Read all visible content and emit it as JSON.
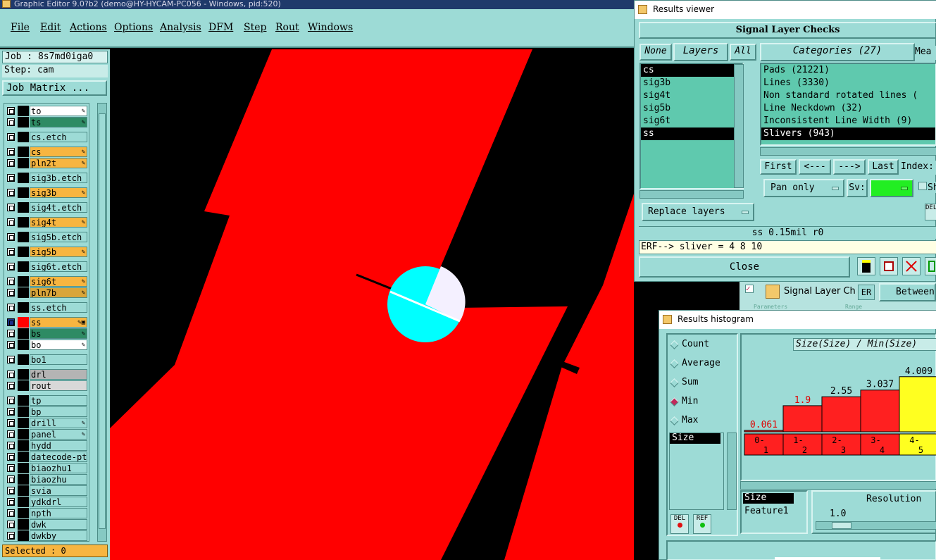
{
  "title_bar": {
    "text": "Graphic Editor 9.0?b2 (demo@HY-HYCAM-PC056 - Windows, pid:520)"
  },
  "menu": [
    "File",
    "Edit",
    "Actions",
    "Options",
    "Analysis",
    "DFM",
    "Step",
    "Rout",
    "Windows"
  ],
  "left_panel": {
    "job": "Job : 8s7md0iga0",
    "step": "Step: cam",
    "job_matrix": "Job Matrix ...",
    "selected": "Selected : 0",
    "layers": [
      {
        "name": "to",
        "bg": "#ffffff",
        "flag": "✎"
      },
      {
        "name": "ts",
        "bg": "#2e8b64",
        "flag": "✎"
      },
      {
        "name": "cs.etch",
        "bg": "#9ddbd6",
        "flag": ""
      },
      {
        "name": "cs",
        "bg": "#f7b540",
        "flag": "✎"
      },
      {
        "name": "pln2t",
        "bg": "#f7b540",
        "flag": "✎"
      },
      {
        "name": "sig3b.etch",
        "bg": "#9ddbd6",
        "flag": ""
      },
      {
        "name": "sig3b",
        "bg": "#f7b540",
        "flag": "✎"
      },
      {
        "name": "sig4t.etch",
        "bg": "#9ddbd6",
        "flag": ""
      },
      {
        "name": "sig4t",
        "bg": "#f7b540",
        "flag": "✎"
      },
      {
        "name": "sig5b.etch",
        "bg": "#9ddbd6",
        "flag": ""
      },
      {
        "name": "sig5b",
        "bg": "#f7b540",
        "flag": "✎"
      },
      {
        "name": "sig6t.etch",
        "bg": "#9ddbd6",
        "flag": ""
      },
      {
        "name": "sig6t",
        "bg": "#f7b540",
        "flag": "✎"
      },
      {
        "name": "pln7b",
        "bg": "#d9a53a",
        "flag": "✎"
      },
      {
        "name": "ss.etch",
        "bg": "#9ddbd6",
        "flag": ""
      },
      {
        "name": "ss",
        "bg": "#f7b540",
        "flag": "✎▣"
      },
      {
        "name": "bs",
        "bg": "#2e8b64",
        "flag": "✎"
      },
      {
        "name": "bo",
        "bg": "#ffffff",
        "flag": "✎"
      },
      {
        "name": "bo1",
        "bg": "#9ddbd6",
        "flag": ""
      },
      {
        "name": "drl",
        "bg": "#b4b4b4",
        "flag": ""
      },
      {
        "name": "rout",
        "bg": "#d8d8d8",
        "flag": ""
      },
      {
        "name": "tp",
        "bg": "#9ddbd6",
        "flag": ""
      },
      {
        "name": "bp",
        "bg": "#9ddbd6",
        "flag": ""
      },
      {
        "name": "drill",
        "bg": "#9ddbd6",
        "flag": "✎"
      },
      {
        "name": "panel",
        "bg": "#9ddbd6",
        "flag": "✎"
      },
      {
        "name": "hydd",
        "bg": "#9ddbd6",
        "flag": ""
      },
      {
        "name": "datecode-ptc",
        "bg": "#9ddbd6",
        "flag": ""
      },
      {
        "name": "biaozhu1",
        "bg": "#9ddbd6",
        "flag": ""
      },
      {
        "name": "biaozhu",
        "bg": "#9ddbd6",
        "flag": ""
      },
      {
        "name": "svia",
        "bg": "#9ddbd6",
        "flag": ""
      },
      {
        "name": "ydkdrl",
        "bg": "#9ddbd6",
        "flag": ""
      },
      {
        "name": "npth",
        "bg": "#9ddbd6",
        "flag": ""
      },
      {
        "name": "dwk",
        "bg": "#9ddbd6",
        "flag": ""
      },
      {
        "name": "dwkby",
        "bg": "#9ddbd6",
        "flag": ""
      }
    ]
  },
  "results_viewer": {
    "title": "Results viewer",
    "header": "Signal Layer Checks",
    "btn_none": "None",
    "btn_layers": "Layers",
    "btn_all": "All",
    "categories_label": "Categories (27)",
    "mea_label": "Mea",
    "layers": [
      "cs",
      "sig3b",
      "sig4t",
      "sig5b",
      "sig6t",
      "ss"
    ],
    "categories": [
      "Pads (21221)",
      "Lines (3330)",
      "Non standard rotated lines (",
      "Line Neckdown (32)",
      "Inconsistent Line Width (9)",
      "Slivers (943)"
    ],
    "nav": [
      "First",
      "<---",
      "--->",
      "Last",
      "Index:"
    ],
    "pan_only": "Pan only",
    "sv_label": "Sv:",
    "sh_label": "Sh",
    "replace_layers": "Replace layers",
    "status": "ss  0.15mil   r0",
    "erf": "ERF--> sliver = 4 8 10",
    "close": "Close",
    "icon_del": "DEL"
  },
  "background_window": {
    "item": "Signal Layer Ch",
    "er": "ER",
    "between": "Between",
    "headers": [
      "Parameters",
      "Range"
    ]
  },
  "results_histogram": {
    "title": "Results histogram",
    "modes": [
      "Count",
      "Average",
      "Sum",
      "Min",
      "Max"
    ],
    "mode_selected": "Min",
    "measure_list": [
      "Size"
    ],
    "chart_caption": "Size(Size) / Min(Size)",
    "del_label": "DEL",
    "ref_label": "REF",
    "secondary_list": [
      "Size",
      "Feature1"
    ],
    "resolution_label": "Resolution",
    "resolution_value": "1.0"
  },
  "chart_data": {
    "type": "bar",
    "categories": [
      "0-1",
      "1-2",
      "2-3",
      "3-4",
      "4-5"
    ],
    "values": [
      0.061,
      1.9,
      2.55,
      3.037,
      4.009
    ],
    "value_labels": [
      "0.061",
      "1.9",
      "2.55",
      "3.037",
      "4.009"
    ],
    "title": "Size(Size) / Min(Size)",
    "colors": [
      "#ff2020",
      "#ff2020",
      "#ff2020",
      "#ff2020",
      "#ffff20"
    ],
    "label_colors": [
      "#e00000",
      "#e00000",
      "#000000",
      "#000000",
      "#000000"
    ],
    "ylim": [
      0,
      4.1
    ]
  },
  "colors": {
    "panel": "#9ddbd6",
    "canvas_bg": "#000000",
    "copper": "#ff0000",
    "circle": "#00ffff",
    "highlight": "#f7b540"
  }
}
